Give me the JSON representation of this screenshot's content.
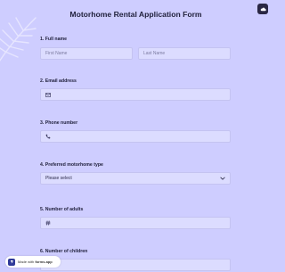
{
  "form": {
    "title": "Motorhome Rental Application Form"
  },
  "questions": [
    {
      "label": "1.  Full name",
      "first_placeholder": "First Name",
      "last_placeholder": "Last Name"
    },
    {
      "label": "2.  Email address",
      "icon": "envelope-icon"
    },
    {
      "label": "3.  Phone number",
      "icon": "phone-icon"
    },
    {
      "label": "4.  Preferred motorhome type",
      "value": "Please select"
    },
    {
      "label": "5.  Number of adults",
      "icon": "hashtag-icon"
    },
    {
      "label": "6.  Number of children"
    }
  ],
  "badge": {
    "prefix": "Made with ",
    "brand": "forms.app"
  },
  "colors": {
    "background": "#cecdff",
    "field": "#dcdcff",
    "title": "#1f1f3a"
  }
}
